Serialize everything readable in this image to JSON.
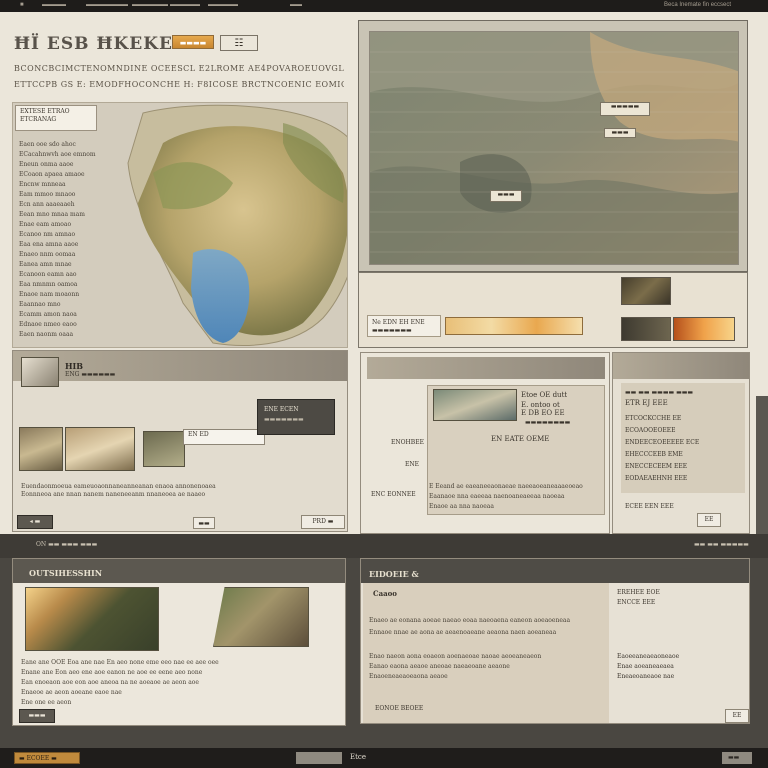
{
  "topbar": {
    "items": [
      "■",
      "▬▬▬▬",
      "▬▬▬▬▬▬▬",
      "▬▬▬▬▬▬",
      "▬▬▬▬▬",
      "▬▬▬▬▬",
      "▬▬"
    ],
    "right_text": "Beca Inemate fin eccsect"
  },
  "header": {
    "title": "ĦÏ ESB ĦKEKER",
    "badge": "▬▬▬▬",
    "icon": "☷",
    "headline_1": "BCONCBCIMCTENOMNDINE OCEESCL E2LROME AE4POVAROEUOVGL",
    "headline_2": "ETTCCPB GS E: EMODFHOCONCHE H: F8ICOSE BRCTNCOENIC EOMIONBEN"
  },
  "map_panel": {
    "label_lines": [
      "EXTESE ETRAO",
      "ETCRANAG"
    ],
    "side_lines": [
      "Eaen ooe sdo ahoc",
      "ECacahnwvh aoe emnom",
      "Eneun onma aaoe",
      "ECoaon apaea amaoe",
      "Encnw mnneaa",
      "Eam mmoo mnaoo",
      "Ecn ann aaaeaaeh",
      "Eean mno mnaa mam",
      "Enae eam amoao",
      "Ecanoo nm amnao",
      "Eaa ena amna aaoe",
      "Enaeo nnm oomaa",
      "Eanea amn mnae",
      "Ecanoon eamn aao",
      "Eaa nmnmn oamoa",
      "Enaoe nam moaonn",
      "Eaannao mno",
      "Ecamm amon naoa",
      "Ednaoe nmeo eaoo",
      "Eaen naonm oaaa"
    ]
  },
  "big_map": {
    "markers": [
      "▬▬▬▬▬",
      "▬▬▬",
      "▬▬▬"
    ]
  },
  "strip": {
    "caption": "Ne EDN EH ENE",
    "caption_sub": "▬▬▬▬▬▬▬"
  },
  "card1": {
    "title": "HIB",
    "subtitle": "ENG ▬▬▬▬▬▬",
    "tag": "EN ED",
    "tag_sub": "▬▬▬▬▬▬",
    "popup": "ENE ECEN",
    "popup_sub": "▬▬▬▬▬▬▬",
    "body_1": "Euendaonmoeua eameuoaonnaneanneanan enaoa annonenoaea",
    "body_2": "Eonnneoa ane nnan nanem naneneeanm nnaneoea ae naaeo",
    "btn_left": "◂ ▬",
    "btn_mid": "▬▬",
    "btn_right": "PRD ▬"
  },
  "card2": {
    "header": "",
    "info_1": "Etoe OE dutt",
    "info_2": "E. ontoo ot",
    "info_3": "E DB EO EE",
    "info_4": "▬▬▬▬▬▬▬▬",
    "center": "EN EATE OEME",
    "side_1": "ENOHBEE",
    "side_2": "ENE",
    "side_3": "ENC EONNEE",
    "body_1": "E Eeand ae eaeaneeaonaeae naeeaoeaneaaaeoeao",
    "body_2": "Eaanaoe nna eaeeaa naenoaneaeeaa naoeaa",
    "body_3": "Enaoe aa nna naoeaa"
  },
  "card3": {
    "title": "ETR EJ EEE",
    "lines": [
      "▬▬ ▬▬ ▬▬▬▬ ▬▬▬",
      "ETCOCKCCHE EE",
      "ECOAOOEOEEE",
      "ENDEECEOEEEEE ECE",
      "EHECCCEEB EME",
      "ENECCECEEM EEE",
      "EODAEAEHNH EEE",
      "ECEE EEN EEE"
    ],
    "button": "EE"
  },
  "band1": {
    "left": "ON ▬▬ ▬▬▬ ▬▬▬",
    "right": "▬▬ ▬▬ ▬▬▬▬▬"
  },
  "card4": {
    "title": "OUTSIHESSHIN",
    "body": [
      "Eane ane OOE Eoa ane nae En aeo none eme eeo nae ee aee oee",
      "Enane ane Eon aeo ene aoe eanon ne aoe ee eene aeo none",
      "Ean enoeaon aoe eon aoe aneoa na ne aoeaoe ae aeon aoe",
      "Enaeoe ae aeon aoeane eaoe nae",
      "Ene one ee aeon"
    ],
    "button": "▬▬▬"
  },
  "card5": {
    "title": "EIDOEIE &",
    "subtitle": "Caaoo",
    "body": [
      "Enaeo ae eonana aoeae naeao eoaa naeoaena eaneon aoeaoeneaa",
      "Ennaoe nnae ae aona ae aeaenoaeane aeaona naen aoeaneaa",
      "Enao naeon aona eoaeon aoenaeoae naoae aeoeaneaeon",
      "Eanao eaona aeaoe aneoae naeaeoane aeaone",
      "Enaoeneaeaoeaona aeaoe"
    ],
    "side": [
      "EREHEE EOE",
      "ENCCE EEE",
      "Eaoeeaneaeaoneaoe",
      "Enae aoeaneaeaea",
      "Eneaeoaneaoe nae"
    ],
    "foot": "EONOE BEOEE",
    "button": "EE"
  },
  "footer": {
    "left": "▬ ECOEE ▬",
    "mid": "Etce",
    "right": "▬▬"
  }
}
